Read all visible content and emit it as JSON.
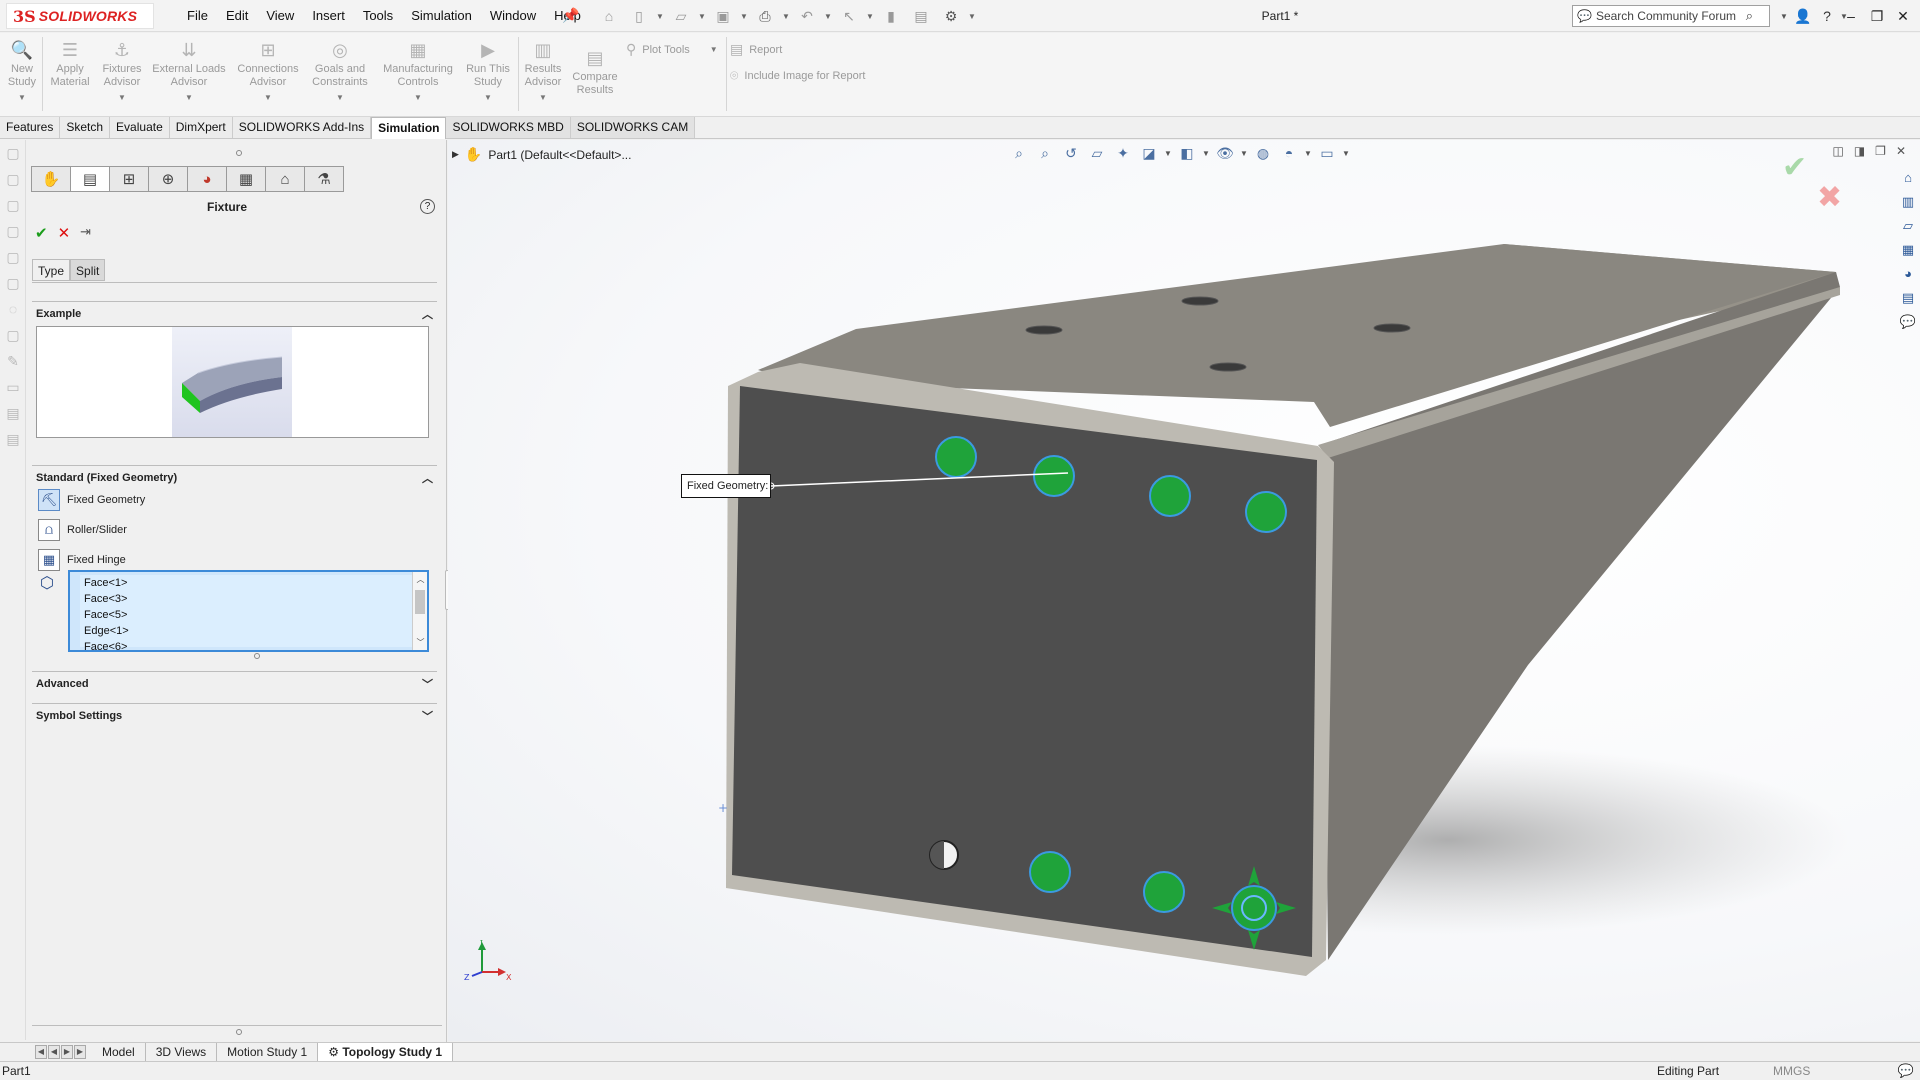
{
  "app": {
    "logo_ds": "3S",
    "logo_name": "SOLIDWORKS",
    "doc_title": "Part1 *"
  },
  "menu": [
    "File",
    "Edit",
    "View",
    "Insert",
    "Tools",
    "Simulation",
    "Window",
    "Help"
  ],
  "search": {
    "placeholder": "Search Community Forum"
  },
  "ribbon": {
    "buttons": [
      {
        "label1": "New",
        "label2": "Study"
      },
      {
        "label1": "Apply",
        "label2": "Material"
      },
      {
        "label1": "Fixtures",
        "label2": "Advisor"
      },
      {
        "label1": "External Loads",
        "label2": "Advisor"
      },
      {
        "label1": "Connections",
        "label2": "Advisor"
      },
      {
        "label1": "Goals and",
        "label2": "Constraints"
      },
      {
        "label1": "Manufacturing",
        "label2": "Controls"
      },
      {
        "label1": "Run This",
        "label2": "Study"
      },
      {
        "label1": "Results",
        "label2": "Advisor"
      },
      {
        "label1": "Compare",
        "label2": "Results"
      }
    ],
    "plot_tools": "Plot Tools",
    "report": "Report",
    "include_image": "Include Image for Report"
  },
  "tabs": [
    "Features",
    "Sketch",
    "Evaluate",
    "DimXpert",
    "SOLIDWORKS Add-Ins",
    "Simulation",
    "SOLIDWORKS MBD",
    "SOLIDWORKS CAM"
  ],
  "active_tab": "Simulation",
  "property_manager": {
    "title": "Fixture",
    "subtabs": [
      "Type",
      "Split"
    ],
    "example_header": "Example",
    "standard_header": "Standard (Fixed Geometry)",
    "options": [
      "Fixed Geometry",
      "Roller/Slider",
      "Fixed Hinge"
    ],
    "selected_option": "Fixed Geometry",
    "selections": [
      "Face<1>",
      "Face<3>",
      "Face<5>",
      "Edge<1>",
      "Face<6>"
    ],
    "advanced_header": "Advanced",
    "symbol_header": "Symbol Settings"
  },
  "viewport": {
    "tree_label": "Part1  (Default<<Default>...",
    "callout": "Fixed Geometry:",
    "triad": {
      "x": "X",
      "y": "Y",
      "z": "Z"
    }
  },
  "bottom_tabs": [
    "Model",
    "3D Views",
    "Motion Study 1",
    "Topology Study 1"
  ],
  "active_bottom_tab": "Topology Study 1",
  "status": {
    "left": "Part1",
    "mode": "Editing Part",
    "units": "MMGS"
  },
  "colors": {
    "accent": "#d22222",
    "selection": "#3c8ad8",
    "fixture": "#1fa33a",
    "part": "#5a5a5a"
  }
}
